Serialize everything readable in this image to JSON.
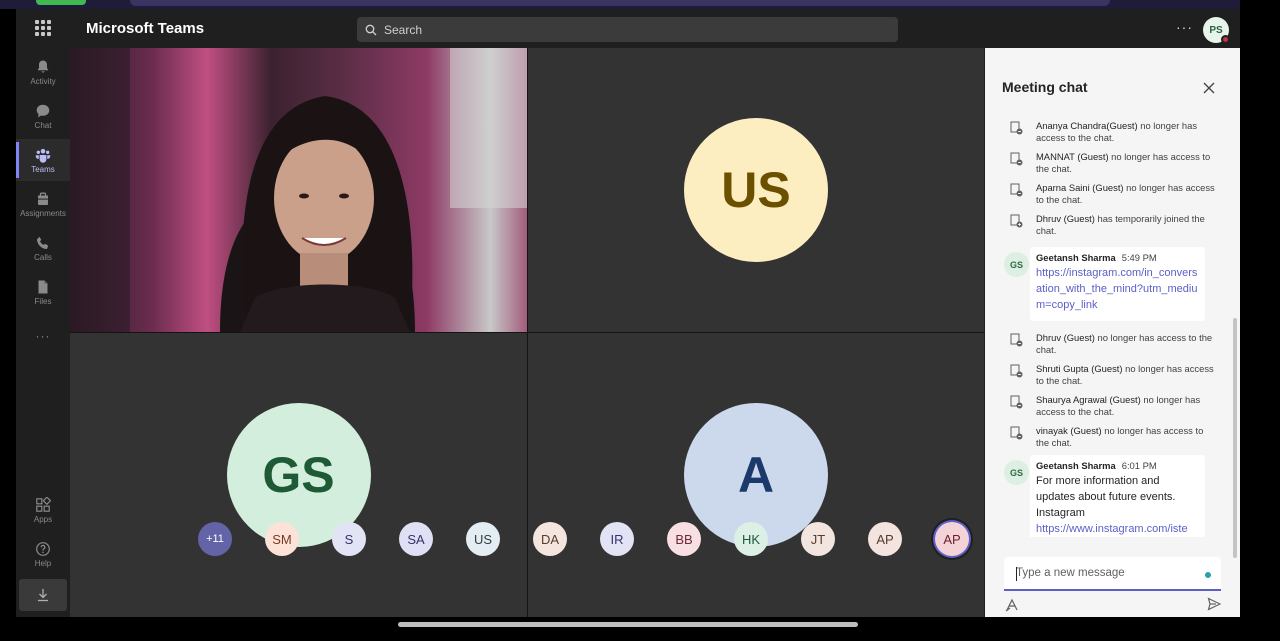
{
  "app": {
    "title": "Microsoft Teams",
    "user_initials": "PS"
  },
  "search": {
    "placeholder": "Search"
  },
  "header": {
    "more": "···"
  },
  "rail": {
    "items": [
      {
        "label": "Activity",
        "icon": "bell-icon"
      },
      {
        "label": "Chat",
        "icon": "chat-icon"
      },
      {
        "label": "Teams",
        "icon": "teams-icon",
        "active": true
      },
      {
        "label": "Assignments",
        "icon": "assignments-icon"
      },
      {
        "label": "Calls",
        "icon": "phone-icon"
      },
      {
        "label": "Files",
        "icon": "file-icon"
      }
    ],
    "more": "···",
    "apps": "Apps",
    "help": "Help"
  },
  "stage": {
    "tiles": [
      {
        "kind": "video"
      },
      {
        "initials": "US",
        "bg": "#fdeec2",
        "fg": "#6b5000"
      },
      {
        "initials": "GS",
        "bg": "#d3eedd",
        "fg": "#1e5a36"
      },
      {
        "initials": "A",
        "bg": "#ccd9ed",
        "fg": "#1b3a6b"
      }
    ]
  },
  "people": [
    {
      "initials": "+11",
      "bg": "#6264a7",
      "fg": "#ffffff"
    },
    {
      "initials": "SM",
      "bg": "#fde2d8",
      "fg": "#7a3a22"
    },
    {
      "initials": "S",
      "bg": "#e3e3f6",
      "fg": "#333366"
    },
    {
      "initials": "SA",
      "bg": "#dfe0f6",
      "fg": "#333366"
    },
    {
      "initials": "US",
      "bg": "#e4eef2",
      "fg": "#2d3e45"
    },
    {
      "initials": "DA",
      "bg": "#f4e6df",
      "fg": "#5a3a2a"
    },
    {
      "initials": "IR",
      "bg": "#e2e3f4",
      "fg": "#343470"
    },
    {
      "initials": "BB",
      "bg": "#f8dfe3",
      "fg": "#6b2a35"
    },
    {
      "initials": "HK",
      "bg": "#dcf0e6",
      "fg": "#1f5a3a"
    },
    {
      "initials": "JT",
      "bg": "#f2e4df",
      "fg": "#5a3a2a"
    },
    {
      "initials": "AP",
      "bg": "#f4e4df",
      "fg": "#5a3a2a"
    },
    {
      "initials": "AP",
      "bg": "#f3d2d8",
      "fg": "#6b1f2d",
      "selected": true
    }
  ],
  "chat": {
    "title": "Meeting chat",
    "system_messages_a": [
      {
        "name": "Ananya Chandra(Guest)",
        "text": " no longer has access to the chat."
      },
      {
        "name": "MANNAT (Guest)",
        "text": " no longer has access to the chat."
      },
      {
        "name": "Aparna Saini (Guest)",
        "text": " no longer has access to the chat."
      },
      {
        "name": "Dhruv (Guest)",
        "text": " has temporarily joined the chat."
      }
    ],
    "message1": {
      "initials": "GS",
      "sender": "Geetansh Sharma",
      "time": "5:49 PM",
      "link": "https://instagram.com/in_conversation_with_the_mind?utm_medium=copy_link"
    },
    "system_messages_b": [
      {
        "name": "Dhruv (Guest)",
        "text": " no longer has access to the chat."
      },
      {
        "name": "Shruti Gupta (Guest)",
        "text": " no longer has access to the chat."
      },
      {
        "name": "Shaurya Agrawal (Guest)",
        "text": " no longer has access to the chat."
      },
      {
        "name": "vinayak (Guest)",
        "text": " no longer has access to the chat."
      }
    ],
    "message2": {
      "initials": "GS",
      "sender": "Geetansh Sharma",
      "time": "6:01 PM",
      "text": "For more information and updates about future events.",
      "text2": "Instagram",
      "link": "https://www.instagram.com/iste"
    },
    "compose_placeholder": "Type a new message"
  },
  "colors": {
    "accent": "#5b5fc7",
    "app_bg": "#1f1f1f",
    "tile_bg": "#333333",
    "chat_bg": "#f5f5f5"
  }
}
